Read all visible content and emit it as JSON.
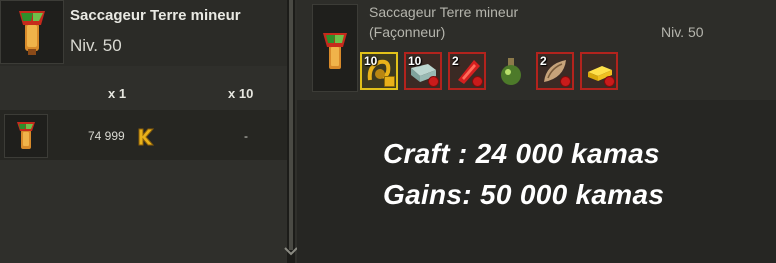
{
  "left": {
    "item_name": "Saccageur Terre mineur",
    "level": "Niv. 50",
    "columns": [
      "x 1",
      "x 10"
    ],
    "row": {
      "price_x1": "74 999",
      "price_x10": "-"
    }
  },
  "right": {
    "item_name": "Saccageur Terre mineur",
    "profession": "(Façonneur)",
    "level": "Niv. 50",
    "ingredients": [
      {
        "qty": "10",
        "icon": "horn-icon",
        "status": "warning"
      },
      {
        "qty": "10",
        "icon": "stone-block-icon",
        "status": "missing"
      },
      {
        "qty": "2",
        "icon": "red-crystal-icon",
        "status": "missing"
      },
      {
        "qty": "",
        "icon": "potion-flask-icon",
        "status": "available"
      },
      {
        "qty": "2",
        "icon": "wing-scroll-icon",
        "status": "missing"
      },
      {
        "qty": "",
        "icon": "gold-bar-icon",
        "status": "missing"
      }
    ]
  },
  "overlay": {
    "craft": "Craft : 24 000 kamas",
    "gains": "Gains: 50 000 kamas"
  },
  "colors": {
    "accent_missing": "#b3231d",
    "accent_warning": "#e2c21a",
    "kama_gold": "#e9b21a"
  }
}
